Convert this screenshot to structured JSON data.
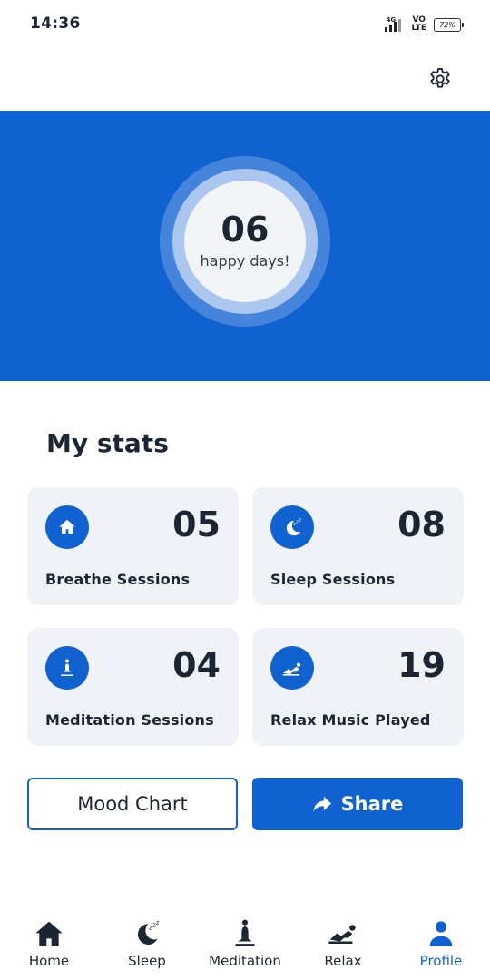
{
  "status_bar": {
    "time": "14:36",
    "network": "4G",
    "volte_top": "VO",
    "volte_bottom": "LTE",
    "battery": "72%"
  },
  "colors": {
    "primary": "#1162d1",
    "card_bg": "#eff3f8",
    "text": "#1b2533"
  },
  "header": {
    "settings_icon": "gear-icon"
  },
  "hero": {
    "count": "06",
    "label": "happy days!"
  },
  "stats": {
    "title": "My stats",
    "cards": [
      {
        "icon": "home-icon",
        "value": "05",
        "label": "Breathe Sessions"
      },
      {
        "icon": "moon-sleep-icon",
        "value": "08",
        "label": "Sleep Sessions"
      },
      {
        "icon": "meditation-icon",
        "value": "04",
        "label": "Meditation Sessions"
      },
      {
        "icon": "relax-icon",
        "value": "19",
        "label": "Relax Music Played"
      }
    ]
  },
  "actions": {
    "mood_chart": "Mood Chart",
    "share": "Share",
    "share_icon": "share-arrow-icon"
  },
  "bottom_nav": {
    "items": [
      {
        "label": "Home",
        "icon": "home-icon",
        "active": false
      },
      {
        "label": "Sleep",
        "icon": "moon-sleep-icon",
        "active": false
      },
      {
        "label": "Meditation",
        "icon": "meditation-icon",
        "active": false
      },
      {
        "label": "Relax",
        "icon": "relax-icon",
        "active": false
      },
      {
        "label": "Profile",
        "icon": "person-icon",
        "active": true
      }
    ]
  }
}
